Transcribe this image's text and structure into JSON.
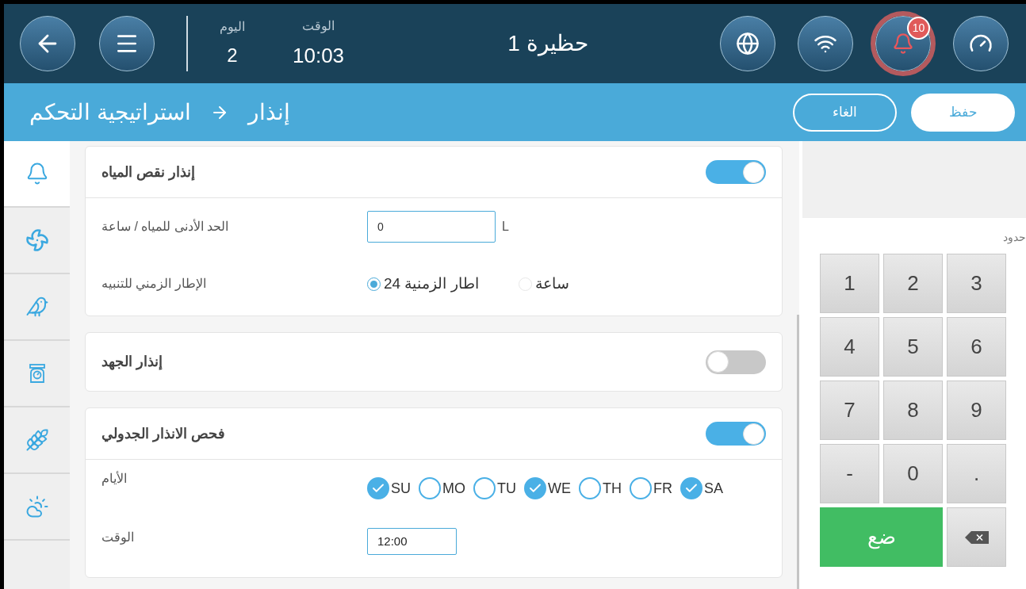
{
  "header": {
    "day_label": "اليوم",
    "day": "2",
    "time_label": "الوقت",
    "time": "10:03",
    "title": "حظيرة 1",
    "alarm_badge": "10"
  },
  "toolbar": {
    "breadcrumb": [
      "إنذار",
      "استراتيجية التحكم"
    ],
    "cancel": "الغاء",
    "save": "حفظ"
  },
  "sidebar": {
    "items": [
      {
        "kind": "bell",
        "selected": true
      },
      {
        "kind": "fan",
        "selected": false
      },
      {
        "kind": "bird",
        "selected": false
      },
      {
        "kind": "scale",
        "selected": false
      },
      {
        "kind": "wheat",
        "selected": false
      },
      {
        "kind": "weather",
        "selected": false
      }
    ]
  },
  "sections": [
    {
      "title": "إنذار نقص المياه",
      "on": true,
      "rows": [
        {
          "kind": "number",
          "label": "الحد الأدنى للمياه / ساعة",
          "value": "0",
          "unit": "L"
        },
        {
          "kind": "radio",
          "label": "الإطار الزمني للتنبيه",
          "options": [
            {
              "label": "ساعة",
              "selected": false
            },
            {
              "label": "اطار الزمنية 24",
              "selected": true
            }
          ]
        }
      ]
    },
    {
      "title": "إنذار الجهد",
      "on": false
    },
    {
      "title": "فحص الانذار الجدولي",
      "on": true,
      "rows": [
        {
          "kind": "days",
          "label": "الأيام",
          "days": [
            {
              "label": "SA",
              "checked": true
            },
            {
              "label": "FR",
              "checked": false
            },
            {
              "label": "TH",
              "checked": false
            },
            {
              "label": "WE",
              "checked": true
            },
            {
              "label": "TU",
              "checked": false
            },
            {
              "label": "MO",
              "checked": false
            },
            {
              "label": "SU",
              "checked": true
            }
          ]
        },
        {
          "kind": "time",
          "label": "الوقت",
          "value": "12:00"
        }
      ]
    }
  ],
  "keypad": {
    "label": "حدود",
    "keys": [
      "3",
      "2",
      "1",
      "6",
      "5",
      "4",
      "9",
      "8",
      "7",
      ".",
      "0",
      "-"
    ],
    "enter": "ضع"
  }
}
